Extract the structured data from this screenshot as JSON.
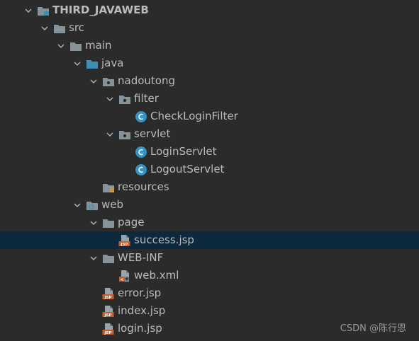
{
  "project_tree": {
    "rows": [
      {
        "label": "THIRD_JAVAWEB",
        "icon": "module-folder-icon",
        "expanded": true,
        "depth": 0
      },
      {
        "label": "src",
        "icon": "folder-icon",
        "expanded": true,
        "depth": 1
      },
      {
        "label": "main",
        "icon": "folder-icon",
        "expanded": true,
        "depth": 2
      },
      {
        "label": "java",
        "icon": "source-root-folder-icon",
        "expanded": true,
        "depth": 3
      },
      {
        "label": "nadoutong",
        "icon": "package-icon",
        "expanded": true,
        "depth": 4
      },
      {
        "label": "filter",
        "icon": "package-icon",
        "expanded": true,
        "depth": 5
      },
      {
        "label": "CheckLoginFilter",
        "icon": "java-class-icon",
        "expanded": null,
        "depth": 6
      },
      {
        "label": "servlet",
        "icon": "package-icon",
        "expanded": true,
        "depth": 5
      },
      {
        "label": "LoginServlet",
        "icon": "java-class-icon",
        "expanded": null,
        "depth": 6
      },
      {
        "label": "LogoutServlet",
        "icon": "java-class-icon",
        "expanded": null,
        "depth": 6
      },
      {
        "label": "resources",
        "icon": "resources-folder-icon",
        "expanded": null,
        "depth": 4
      },
      {
        "label": "web",
        "icon": "web-folder-icon",
        "expanded": true,
        "depth": 3
      },
      {
        "label": "page",
        "icon": "folder-icon",
        "expanded": true,
        "depth": 4
      },
      {
        "label": "success.jsp",
        "icon": "jsp-file-icon",
        "expanded": null,
        "depth": 5,
        "selected": true
      },
      {
        "label": "WEB-INF",
        "icon": "folder-icon",
        "expanded": true,
        "depth": 4
      },
      {
        "label": "web.xml",
        "icon": "xml-config-file-icon",
        "expanded": null,
        "depth": 5
      },
      {
        "label": "error.jsp",
        "icon": "jsp-file-icon",
        "expanded": null,
        "depth": 4
      },
      {
        "label": "index.jsp",
        "icon": "jsp-file-icon",
        "expanded": null,
        "depth": 4
      },
      {
        "label": "login.jsp",
        "icon": "jsp-file-icon",
        "expanded": null,
        "depth": 4
      }
    ]
  },
  "watermark": "CSDN @陈行恩",
  "colors": {
    "background": "#2b2b2b",
    "selection": "#0d293e",
    "folder": "#87939a",
    "source_root": "#3d8fb5",
    "class_circle": "#3592c4",
    "jsp_orange": "#c75c2e",
    "text": "#bbbbbb"
  }
}
